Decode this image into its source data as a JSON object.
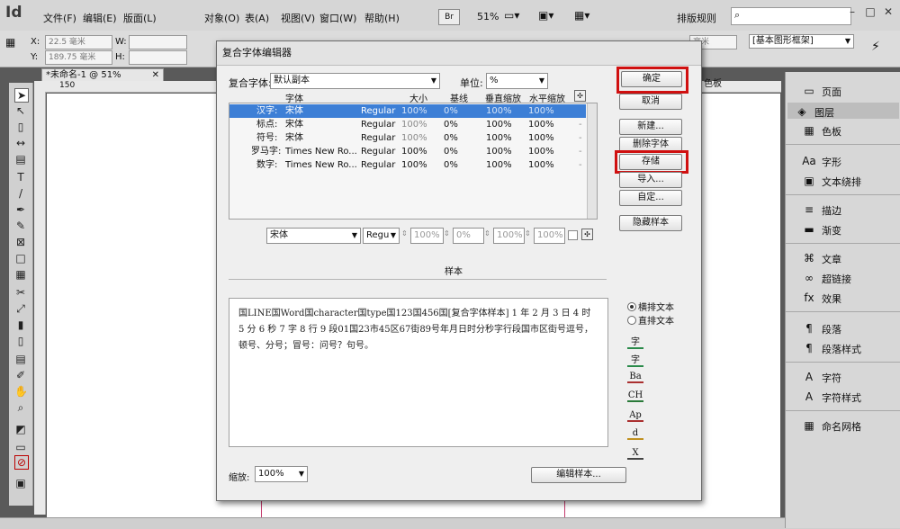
{
  "app": {
    "logo": "Id",
    "zoom": "51%",
    "workspace": "排版规则",
    "br_label": "Br"
  },
  "menus": [
    "文件(F)",
    "编辑(E)",
    "版面(L)",
    "对象(O)",
    "表(A)",
    "视图(V)",
    "窗口(W)",
    "帮助(H)"
  ],
  "control": {
    "x_label": "X:",
    "x_value": "22.5 毫米",
    "y_label": "Y:",
    "y_value": "189.75 毫米",
    "w_label": "W:",
    "h_label": "H:",
    "stroke_value": "毫米",
    "style_value": "[基本图形框架]"
  },
  "doc_tab": "*未命名-1 @ 51%",
  "ruler_mark": "150",
  "right_panel": [
    {
      "icon": "pages-icon",
      "glyph": "▭",
      "label": "页面"
    },
    {
      "icon": "layers-icon",
      "glyph": "◈",
      "label": "图层"
    },
    {
      "icon": "swatches-icon",
      "glyph": "▦",
      "label": "色板"
    },
    {
      "icon": "glyph-icon",
      "glyph": "Aa",
      "label": "字形"
    },
    {
      "icon": "text-wrap-icon",
      "glyph": "▣",
      "label": "文本绕排"
    },
    {
      "icon": "stroke-icon",
      "glyph": "≡",
      "label": "描边"
    },
    {
      "icon": "gradient-icon",
      "glyph": "▬",
      "label": "渐变"
    },
    {
      "icon": "story-icon",
      "glyph": "⌘",
      "label": "文章"
    },
    {
      "icon": "hyperlink-icon",
      "glyph": "∞",
      "label": "超链接"
    },
    {
      "icon": "effects-icon",
      "glyph": "fx",
      "label": "效果"
    },
    {
      "icon": "paragraph-icon",
      "glyph": "¶",
      "label": "段落"
    },
    {
      "icon": "paragraph-style-icon",
      "glyph": "¶",
      "label": "段落样式"
    },
    {
      "icon": "character-icon",
      "glyph": "A",
      "label": "字符"
    },
    {
      "icon": "character-style-icon",
      "glyph": "A",
      "label": "字符样式"
    },
    {
      "icon": "named-grid-icon",
      "glyph": "▦",
      "label": "命名网格"
    }
  ],
  "color_tab": "色板",
  "dialog": {
    "title": "复合字体编辑器",
    "font_label": "复合字体:",
    "font_value": "默认副本",
    "unit_label": "单位:",
    "unit_value": "%",
    "headers": [
      "字体",
      "大小",
      "基线",
      "垂直缩放",
      "水平缩放"
    ],
    "rows": [
      {
        "label": "汉字:",
        "font": "宋体",
        "style": "Regular",
        "size": "100%",
        "baseline": "0%",
        "vscale": "100%",
        "hscale": "100%",
        "extra": "",
        "selected": true
      },
      {
        "label": "标点:",
        "font": "宋体",
        "style": "Regular",
        "size": "100%",
        "baseline": "0%",
        "vscale": "100%",
        "hscale": "100%",
        "extra": "-",
        "selected": false
      },
      {
        "label": "符号:",
        "font": "宋体",
        "style": "Regular",
        "size": "100%",
        "baseline": "0%",
        "vscale": "100%",
        "hscale": "100%",
        "extra": "-",
        "selected": false
      },
      {
        "label": "罗马字:",
        "font": "Times New Ro...",
        "style": "Regular",
        "size": "100%",
        "baseline": "0%",
        "vscale": "100%",
        "hscale": "100%",
        "extra": "-",
        "selected": false
      },
      {
        "label": "数字:",
        "font": "Times New Ro...",
        "style": "Regular",
        "size": "100%",
        "baseline": "0%",
        "vscale": "100%",
        "hscale": "100%",
        "extra": "-",
        "selected": false
      }
    ],
    "edit_font": "宋体",
    "edit_style": "Regu",
    "edit_size": "100%",
    "edit_baseline": "0%",
    "edit_vscale": "100%",
    "edit_hscale": "100%",
    "sample_label": "样本",
    "sample_text": "国LINE国Word国character国type国123国456国[复合字体样本] 1 年 2 月 3 日 4 时 5 分 6 秒 7 字 8 行 9 段01国23市45区67街89号年月日时分秒字行段国市区街号逗号，顿号、分号；冒号：问号？句号。",
    "radio_horizontal": "横排文本",
    "radio_vertical": "直排文本",
    "zoom_label": "缩放:",
    "zoom_value": "100%",
    "buttons": {
      "ok": "确定",
      "cancel": "取消",
      "new": "新建...",
      "delete": "删除字体",
      "save": "存储",
      "import": "导入...",
      "custom": "自定...",
      "hide_sample": "隐藏样本",
      "edit_sample": "编辑样本..."
    },
    "sample_icons": [
      "字",
      "字",
      "Ba",
      "CH",
      "Ap",
      "d",
      "X"
    ],
    "highlight_color": "#d01010",
    "selection_color": "#3d7fd6"
  }
}
